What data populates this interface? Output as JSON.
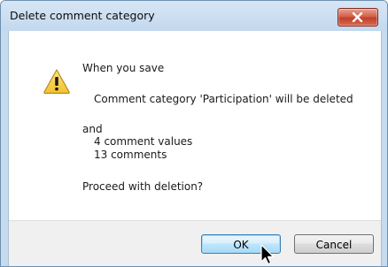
{
  "dialog": {
    "title": "Delete comment category",
    "close_icon": "close-icon",
    "warning_icon": "warning-icon"
  },
  "message": {
    "line1": "When you save",
    "line2": "Comment category 'Participation' will be deleted",
    "line3": "and",
    "line4": "4 comment values",
    "line5": "13 comments",
    "line6": "Proceed with deletion?"
  },
  "buttons": {
    "ok": "OK",
    "cancel": "Cancel"
  },
  "colors": {
    "titlebar": "#c7dbef",
    "close_button": "#c74a34",
    "footer": "#f0f0f0",
    "default_button_border": "#3c7fb1"
  }
}
